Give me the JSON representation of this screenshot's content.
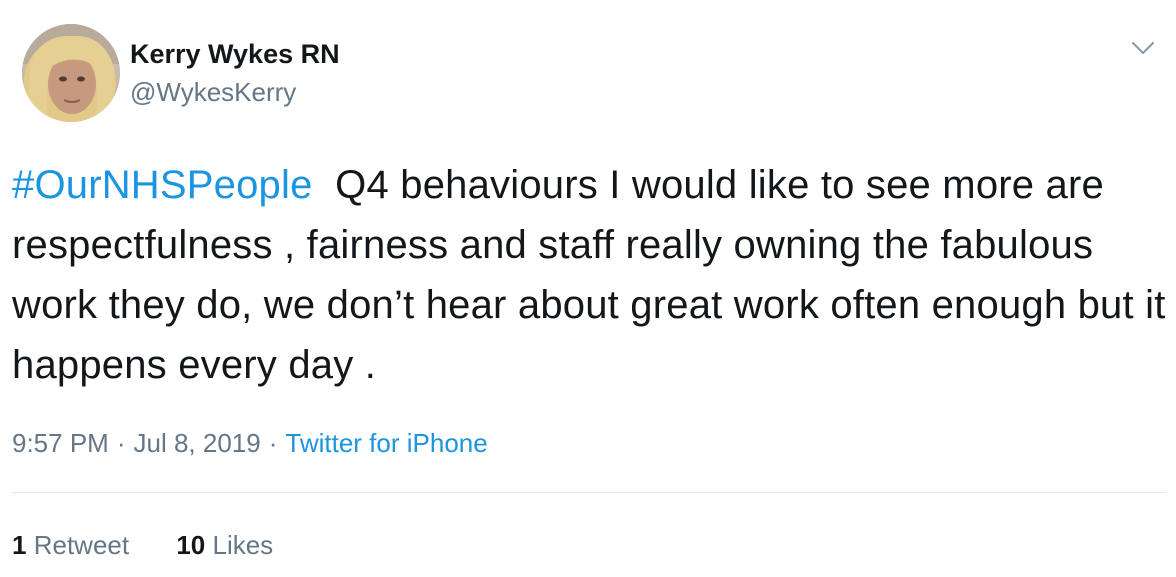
{
  "author": {
    "display_name": "Kerry Wykes RN",
    "handle": "@WykesKerry"
  },
  "tweet": {
    "hashtag": "#OurNHSPeople",
    "text": "Q4 behaviours I would like to see more are respectfulness , fairness and staff really owning the fabulous work they do, we don’t hear about great work often enough but it happens every day ."
  },
  "meta": {
    "time": "9:57 PM",
    "separator": "·",
    "date": "Jul 8, 2019",
    "source": "Twitter for iPhone"
  },
  "stats": {
    "retweets_count": "1",
    "retweets_label": "Retweet",
    "likes_count": "10",
    "likes_label": "Likes"
  },
  "icons": {
    "menu": "chevron-down-icon"
  },
  "colors": {
    "link": "#1b95e0",
    "secondary_text": "#657786",
    "primary_text": "#14171a",
    "divider": "#e1e8ed"
  }
}
